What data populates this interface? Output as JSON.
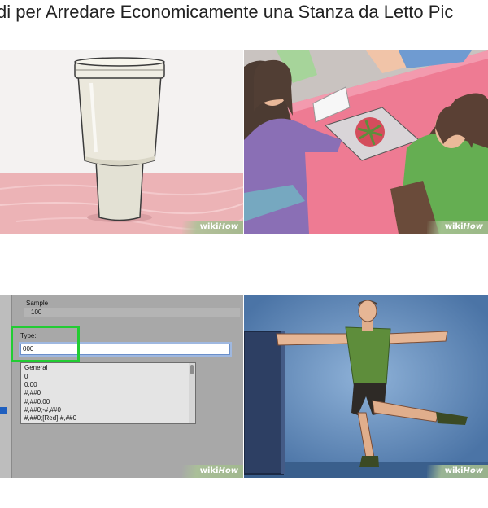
{
  "page": {
    "title": "di per Arredare Economicamente una Stanza da Letto Pic"
  },
  "watermark": {
    "brand": "wiki",
    "suffix": "How"
  },
  "tiles": [
    {
      "name": "plastic-cup-image",
      "alt": ""
    },
    {
      "name": "drawing-table-image",
      "alt": ""
    },
    {
      "name": "format-dialog-image",
      "alt": ""
    },
    {
      "name": "stretching-man-image",
      "alt": ""
    }
  ],
  "format_dialog": {
    "sample_label": "Sample",
    "sample_value": "100",
    "type_label": "Type:",
    "type_value": "000",
    "formats": [
      "General",
      "0",
      "0.00",
      "#,##0",
      "#,##0.00",
      "#,##0;-#,##0",
      "#,##0;[Red]-#,##0"
    ]
  },
  "colors": {
    "accent_green": "#22cc33",
    "dialog_bg": "#a8a8a8",
    "wall_blue": "#5f87b6",
    "table_pink": "#f07a92"
  }
}
